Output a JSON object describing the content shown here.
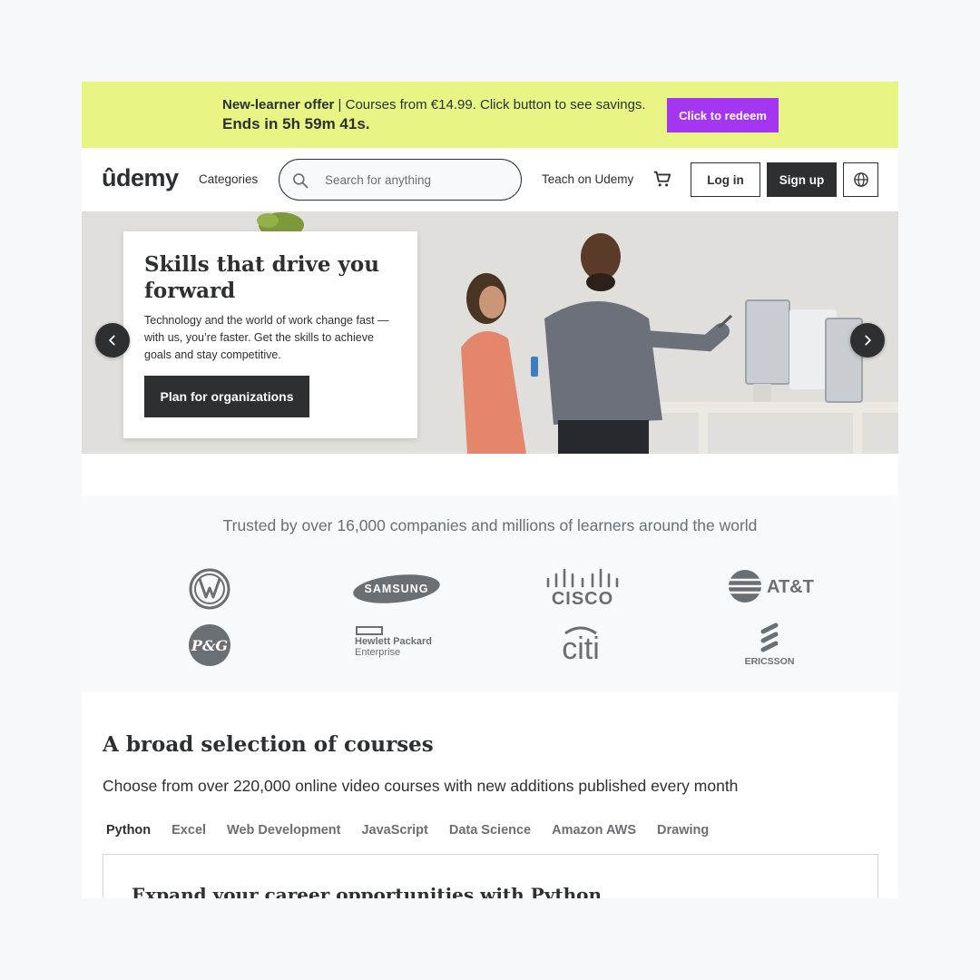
{
  "promo": {
    "label": "New-learner offer",
    "text": " | Courses from €14.99. Click button to see savings.",
    "countdown": "Ends in 5h 59m 41s.",
    "button": "Click to redeem"
  },
  "header": {
    "logo": "ûdemy",
    "categories": "Categories",
    "search_placeholder": "Search for anything",
    "teach": "Teach on Udemy",
    "login": "Log in",
    "signup": "Sign up"
  },
  "hero": {
    "title": "Skills that drive you forward",
    "text": "Technology and the world of work change fast — with us, you’re faster. Get the skills to achieve goals and stay competitive.",
    "button": "Plan for organizations"
  },
  "trusted": {
    "title": "Trusted by over 16,000 companies and millions of learners around the world",
    "logos": [
      "Volkswagen",
      "SAMSUNG",
      "CISCO",
      "AT&T",
      "P&G",
      "Hewlett Packard Enterprise",
      "citi",
      "ERICSSON"
    ]
  },
  "courses": {
    "title": "A broad selection of courses",
    "subtitle": "Choose from over 220,000 online video courses with new additions published every month",
    "tabs": [
      "Python",
      "Excel",
      "Web Development",
      "JavaScript",
      "Data Science",
      "Amazon AWS",
      "Drawing"
    ],
    "active_tab": "Python",
    "box_title": "Expand your career opportunities with Python"
  },
  "colors": {
    "promo_bg": "#e8f584",
    "accent": "#a435f0",
    "dark": "#2d2f31"
  }
}
